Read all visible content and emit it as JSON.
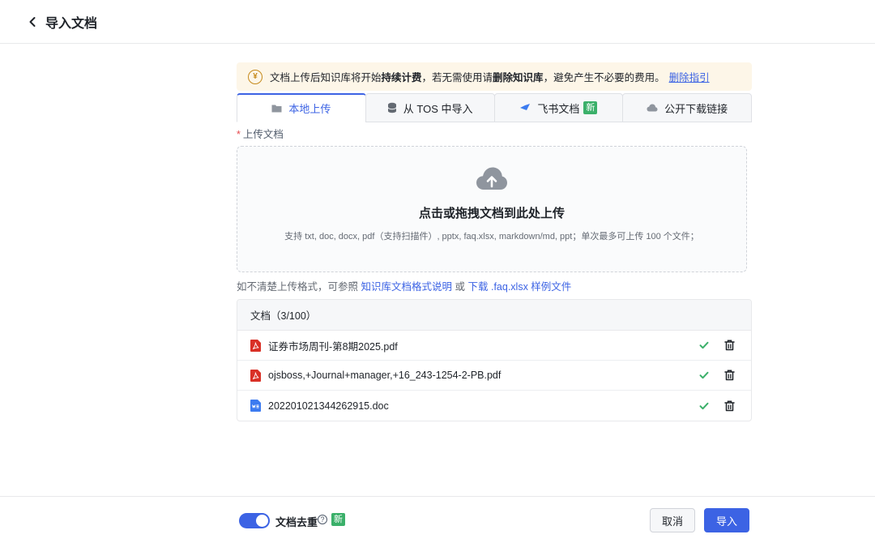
{
  "header": {
    "title": "导入文档"
  },
  "notice": {
    "p1": "文档上传后知识库将开始",
    "b1": "持续计费",
    "p2": "，若无需使用请",
    "b2": "删除知识库",
    "p3": "，避免产生不必要的费用。",
    "link": "删除指引",
    "icon": "yen-icon",
    "icon_glyph": "¥"
  },
  "tabs": [
    {
      "label": "本地上传",
      "icon": "folder-icon",
      "active": true
    },
    {
      "label": "从 TOS 中导入",
      "icon": "database-icon"
    },
    {
      "label": "飞书文档",
      "icon": "feishu-icon",
      "badge": "新"
    },
    {
      "label": "公开下载链接",
      "icon": "cloud-link-icon"
    }
  ],
  "upload": {
    "required_mark": "*",
    "label": "上传文档",
    "title": "点击或拖拽文档到此处上传",
    "hint": "支持 txt, doc, docx, pdf（支持扫描件）, pptx, faq.xlsx, markdown/md, ppt；单次最多可上传 100 个文件；"
  },
  "help": {
    "prefix": "如不清楚上传格式，可参照",
    "link1": "知识库文档格式说明",
    "middle": "或",
    "link2": "下载 .faq.xlsx 样例文件"
  },
  "documents": {
    "header": "文档（3/100）",
    "items": [
      {
        "name": "证券市场周刊-第8期2025.pdf",
        "type": "pdf"
      },
      {
        "name": "ojsboss,+Journal+manager,+16_243-1254-2-PB.pdf",
        "type": "pdf"
      },
      {
        "name": "202201021344262915.doc",
        "type": "doc"
      }
    ]
  },
  "footer": {
    "dedup_label": "文档去重",
    "help_glyph": "?",
    "badge": "新",
    "cancel": "取消",
    "import": "导入",
    "dedup_enabled": true
  },
  "colors": {
    "accent": "#3c63e4",
    "success": "#3bb06a",
    "pdf": "#d93026",
    "doc": "#3c7bf0",
    "notice_bg": "#fdf6e8"
  }
}
